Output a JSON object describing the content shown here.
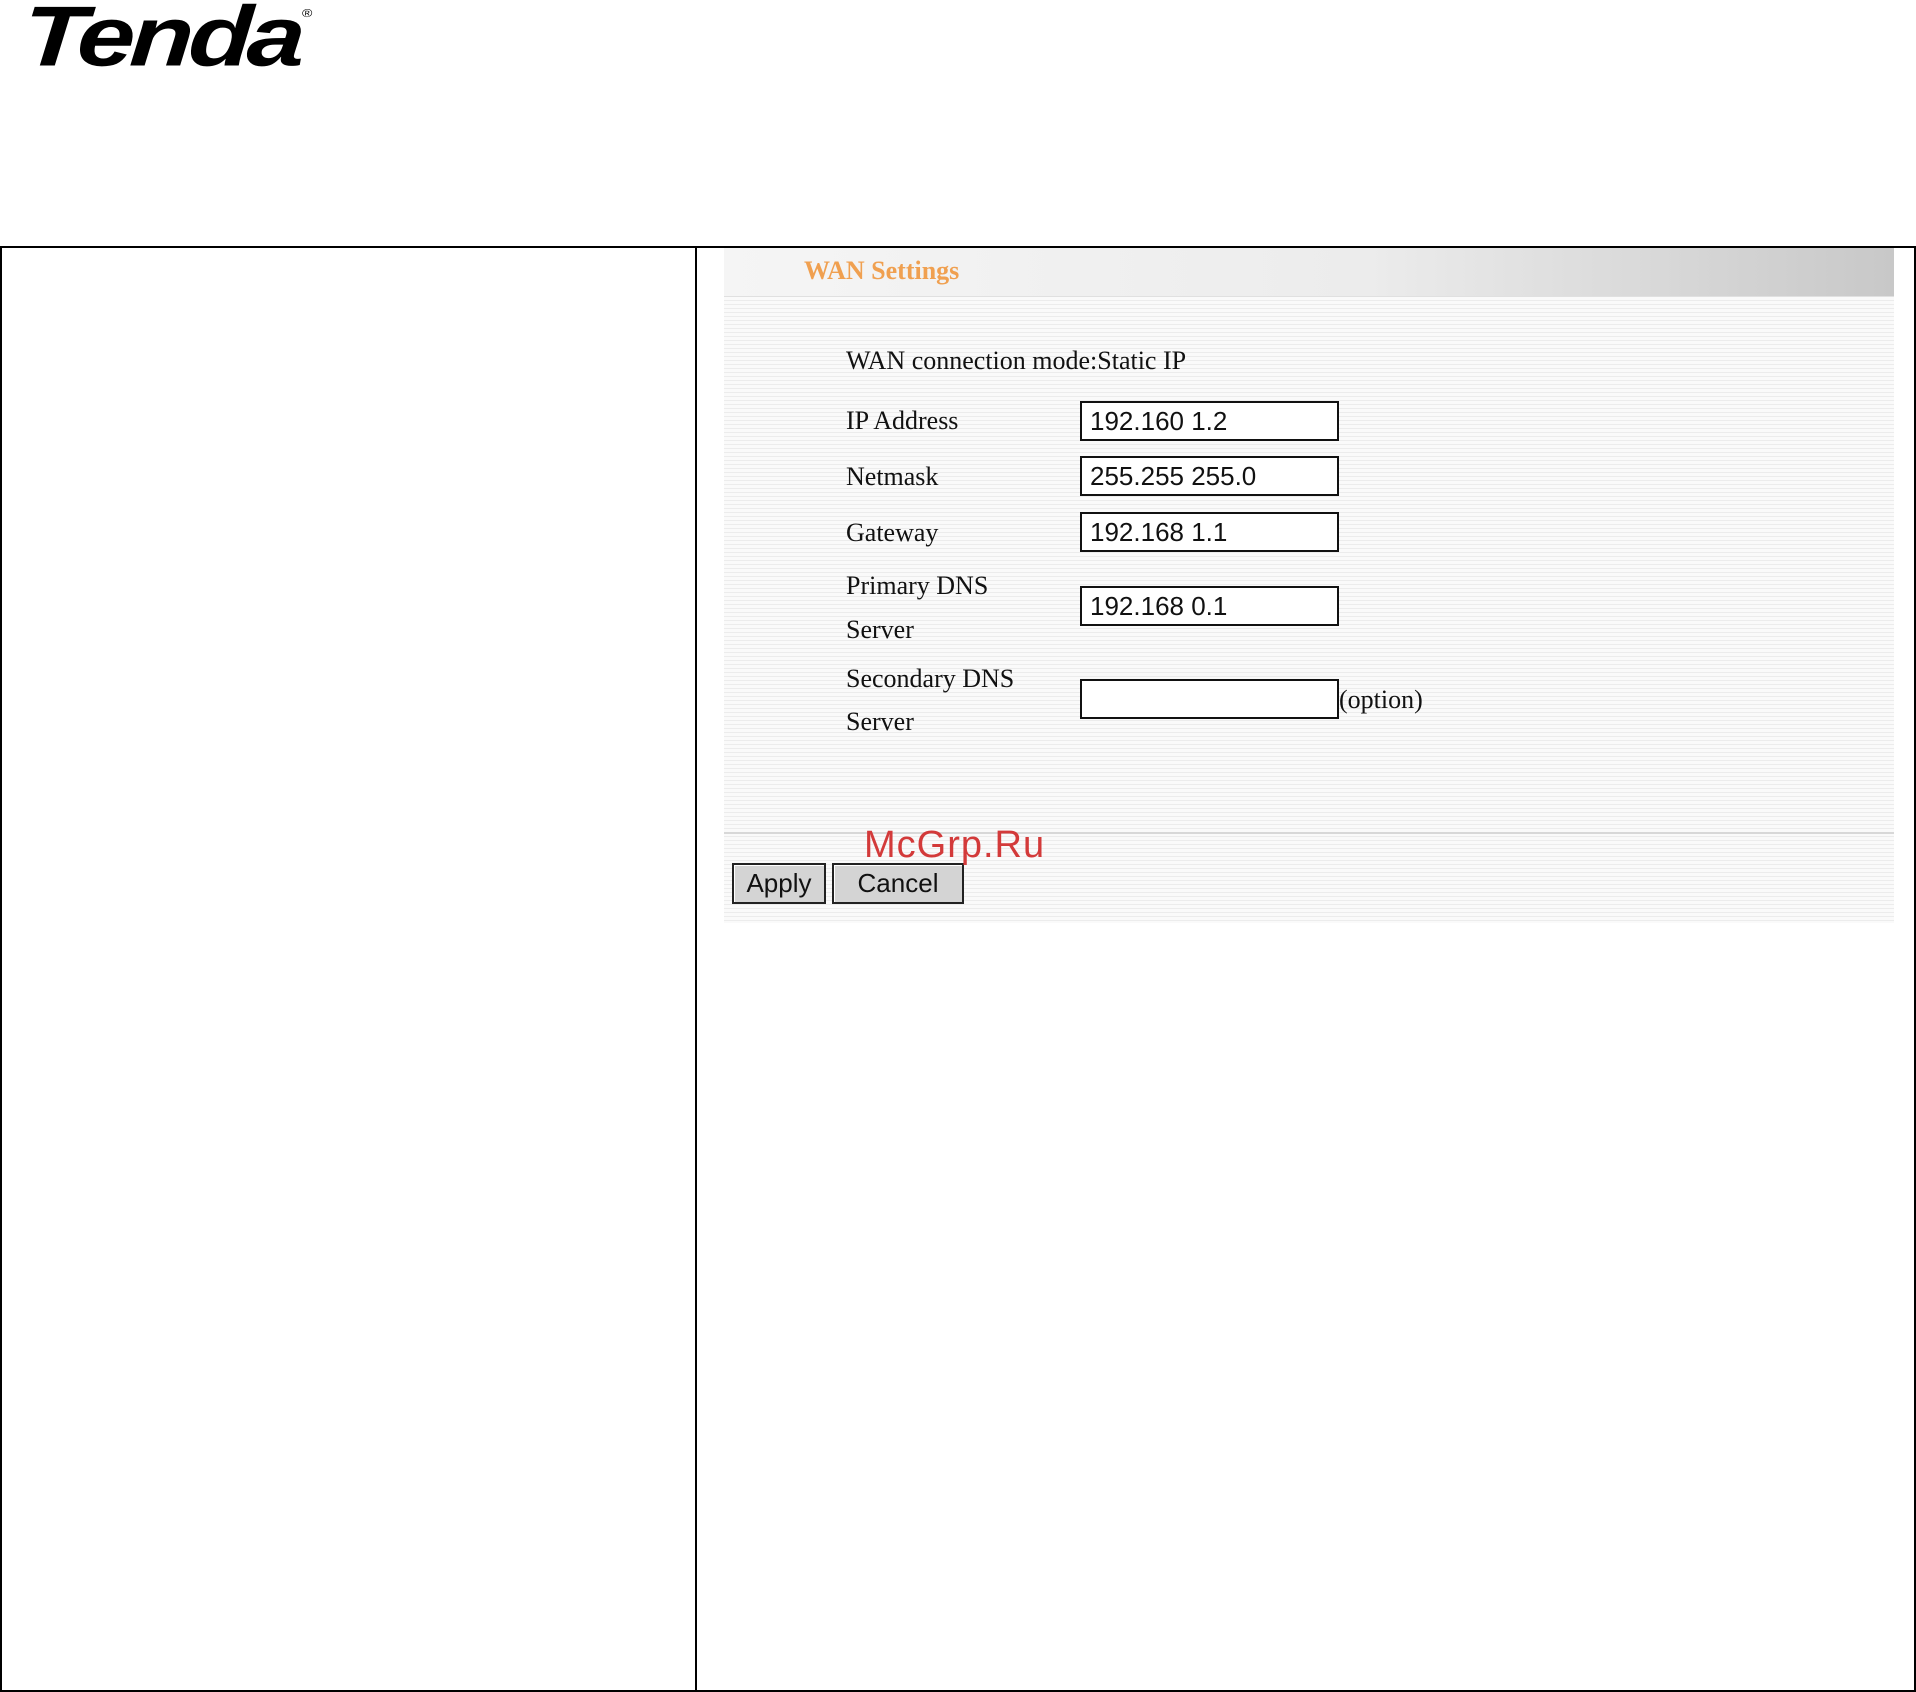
{
  "logo": {
    "text": "Tenda",
    "mark": "®"
  },
  "panel": {
    "title": "WAN Settings",
    "mode_text": "WAN connection mode:Static IP",
    "fields": {
      "ip": {
        "label": "IP Address",
        "value": "192.160 1.2"
      },
      "netmask": {
        "label": "Netmask",
        "value": "255.255 255.0"
      },
      "gateway": {
        "label": "Gateway",
        "value": "192.168 1.1"
      },
      "primary_dns": {
        "label_line1": "Primary DNS",
        "label_line2": "Server",
        "value": "192.168 0.1"
      },
      "secondary_dns": {
        "label_line1": "Secondary DNS",
        "label_line2": "Server",
        "value": "",
        "suffix": "(option)"
      }
    },
    "buttons": {
      "apply": "Apply",
      "cancel": "Cancel"
    }
  },
  "watermark": "McGrp.Ru",
  "colors": {
    "title_text": "#f0a050",
    "watermark": "#d33a3a",
    "button_bg": "#d4d4d4"
  }
}
